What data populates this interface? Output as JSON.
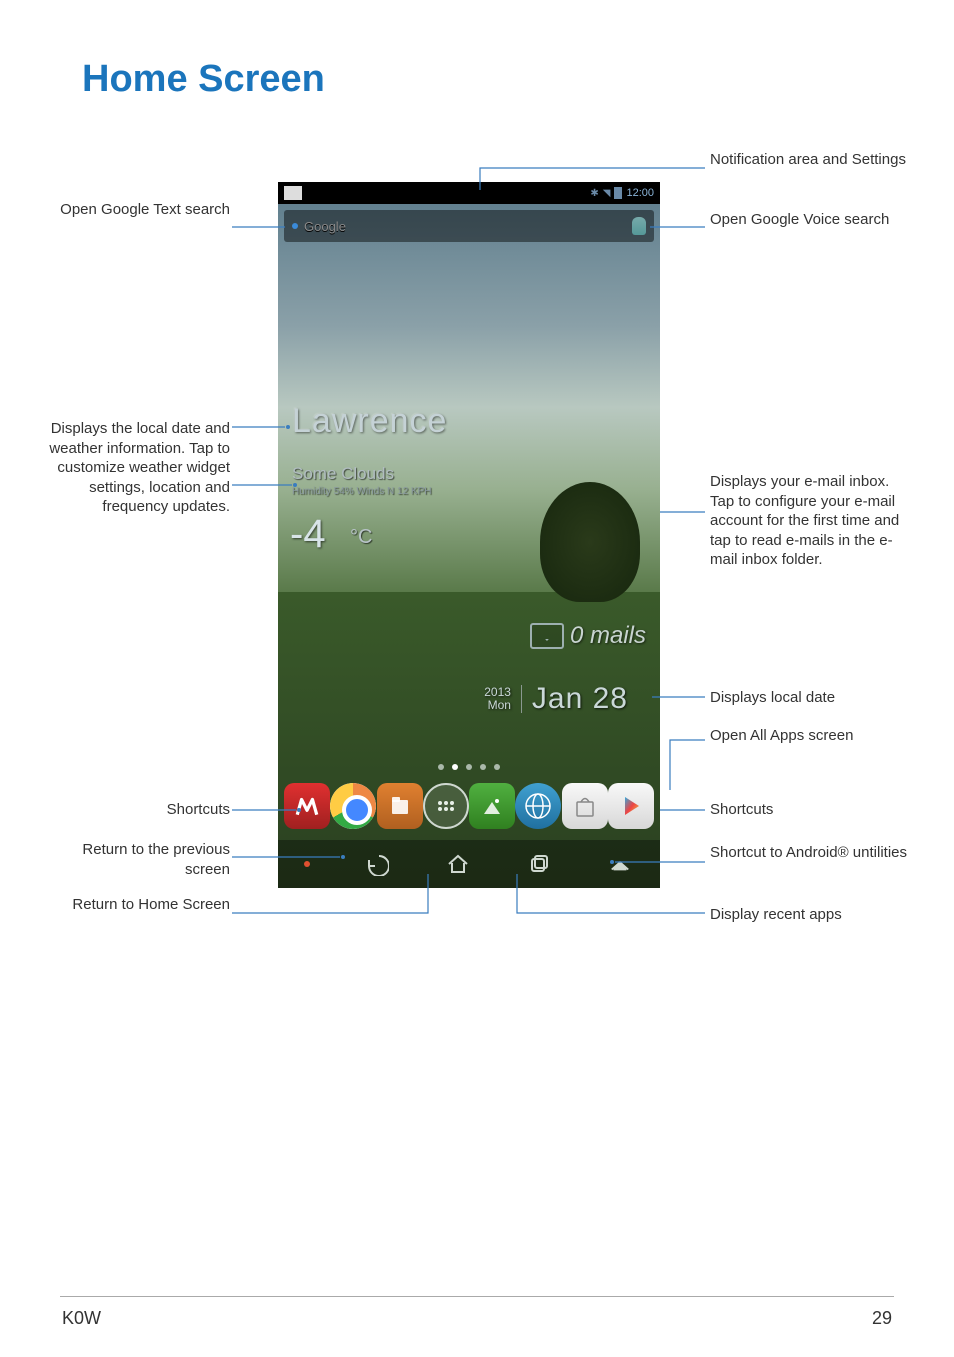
{
  "page": {
    "title": "Home Screen",
    "footer_left": "K0W",
    "footer_right": "29"
  },
  "callouts": {
    "notif": "Notification area and Settings",
    "voice_search": "Open Google Voice search",
    "text_search": "Open Google Text search",
    "weather": "Displays the local date and weather information. Tap to customize weather widget settings, location and frequency updates.",
    "email": "Displays your e-mail inbox. Tap to configure your e-mail account for the first time and tap to read e-mails in the e-mail inbox folder.",
    "date": "Displays local date",
    "all_apps": "Open All Apps screen",
    "shortcuts_l": "Shortcuts",
    "shortcuts_r": "Shortcuts",
    "back": "Return to the previous screen",
    "home": "Return to Home Screen",
    "utilities": "Shortcut to Android® untilities",
    "recent": "Display recent apps"
  },
  "phone": {
    "status_time": "12:00",
    "search_placeholder": "Google",
    "weather": {
      "city": "Lawrence",
      "condition": "Some Clouds",
      "details": "Humidity 54% Winds N 12 KPH",
      "temp": "-4",
      "unit": "°C"
    },
    "email": {
      "count_text": "0 mails"
    },
    "date": {
      "year": "2013",
      "day": "Mon",
      "main": "Jan 28"
    }
  }
}
